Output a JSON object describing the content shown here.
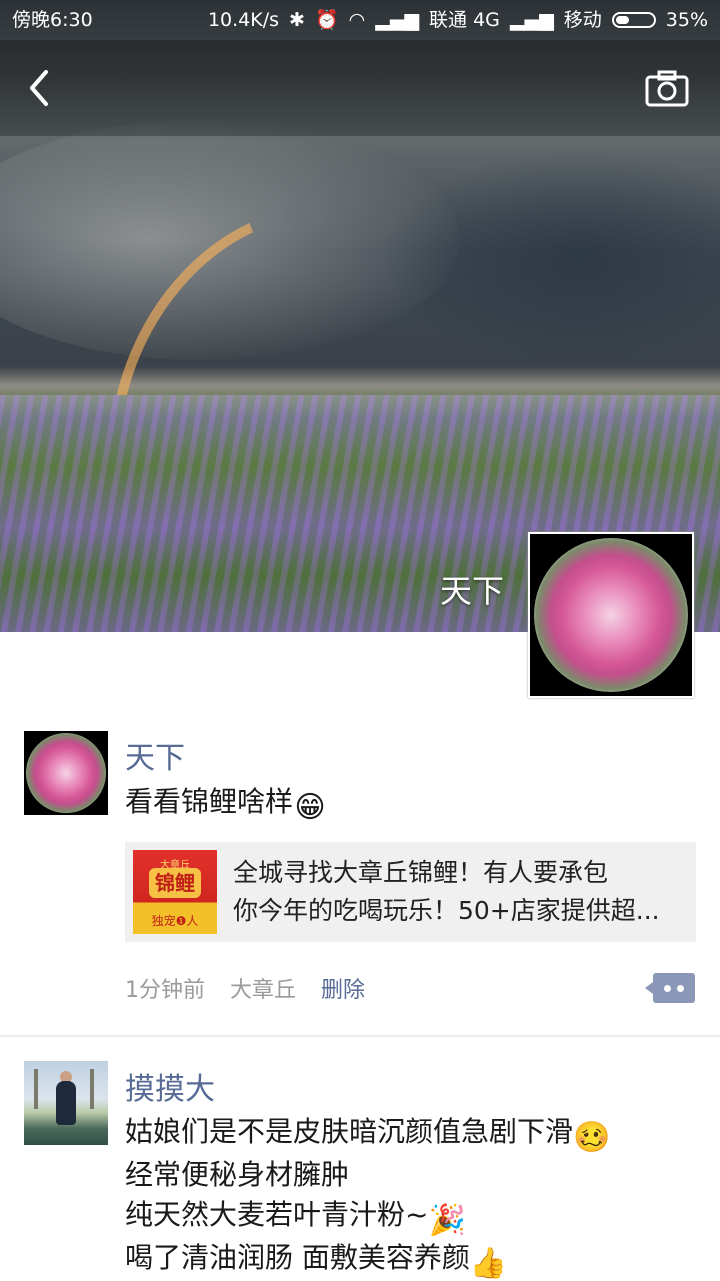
{
  "status_bar": {
    "time": "傍晚6:30",
    "speed": "10.4K/s",
    "carrier1": "联通 4G",
    "carrier2": "移动",
    "battery": "35%",
    "battery_level": 0.35
  },
  "header": {
    "back_icon": "back-arrow-icon",
    "camera_icon": "camera-icon"
  },
  "profile": {
    "name": "天下"
  },
  "posts": [
    {
      "nick": "天下",
      "text": "看看锦鲤啥样",
      "emoji": "😁",
      "share": {
        "thumb_top": "大章丘",
        "thumb_main": "锦鲤",
        "thumb_bottom": "独宠❶人",
        "line1": "全城寻找大章丘锦鲤！有人要承包",
        "line2": "你今年的吃喝玩乐！50+店家提供超..."
      },
      "time": "1分钟前",
      "location": "大章丘",
      "delete_label": "删除"
    },
    {
      "nick": "摸摸大",
      "lines": [
        {
          "text": "姑娘们是不是皮肤暗沉颜值急剧下滑",
          "emoji": "🥴"
        },
        {
          "text": "经常便秘身材臃肿",
          "emoji": ""
        },
        {
          "text": "纯天然大麦若叶青汁粉~",
          "emoji": "🎉"
        },
        {
          "text": "喝了清油润肠 面敷美容养颜",
          "emoji": "👍"
        }
      ]
    }
  ]
}
